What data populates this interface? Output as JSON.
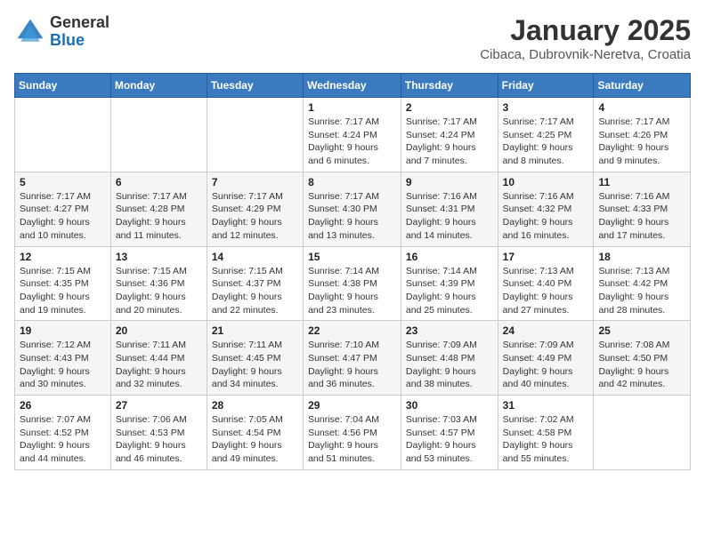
{
  "header": {
    "logo_general": "General",
    "logo_blue": "Blue",
    "month_title": "January 2025",
    "location": "Cibaca, Dubrovnik-Neretva, Croatia"
  },
  "weekdays": [
    "Sunday",
    "Monday",
    "Tuesday",
    "Wednesday",
    "Thursday",
    "Friday",
    "Saturday"
  ],
  "weeks": [
    [
      {
        "day": "",
        "info": ""
      },
      {
        "day": "",
        "info": ""
      },
      {
        "day": "",
        "info": ""
      },
      {
        "day": "1",
        "info": "Sunrise: 7:17 AM\nSunset: 4:24 PM\nDaylight: 9 hours and 6 minutes."
      },
      {
        "day": "2",
        "info": "Sunrise: 7:17 AM\nSunset: 4:24 PM\nDaylight: 9 hours and 7 minutes."
      },
      {
        "day": "3",
        "info": "Sunrise: 7:17 AM\nSunset: 4:25 PM\nDaylight: 9 hours and 8 minutes."
      },
      {
        "day": "4",
        "info": "Sunrise: 7:17 AM\nSunset: 4:26 PM\nDaylight: 9 hours and 9 minutes."
      }
    ],
    [
      {
        "day": "5",
        "info": "Sunrise: 7:17 AM\nSunset: 4:27 PM\nDaylight: 9 hours and 10 minutes."
      },
      {
        "day": "6",
        "info": "Sunrise: 7:17 AM\nSunset: 4:28 PM\nDaylight: 9 hours and 11 minutes."
      },
      {
        "day": "7",
        "info": "Sunrise: 7:17 AM\nSunset: 4:29 PM\nDaylight: 9 hours and 12 minutes."
      },
      {
        "day": "8",
        "info": "Sunrise: 7:17 AM\nSunset: 4:30 PM\nDaylight: 9 hours and 13 minutes."
      },
      {
        "day": "9",
        "info": "Sunrise: 7:16 AM\nSunset: 4:31 PM\nDaylight: 9 hours and 14 minutes."
      },
      {
        "day": "10",
        "info": "Sunrise: 7:16 AM\nSunset: 4:32 PM\nDaylight: 9 hours and 16 minutes."
      },
      {
        "day": "11",
        "info": "Sunrise: 7:16 AM\nSunset: 4:33 PM\nDaylight: 9 hours and 17 minutes."
      }
    ],
    [
      {
        "day": "12",
        "info": "Sunrise: 7:15 AM\nSunset: 4:35 PM\nDaylight: 9 hours and 19 minutes."
      },
      {
        "day": "13",
        "info": "Sunrise: 7:15 AM\nSunset: 4:36 PM\nDaylight: 9 hours and 20 minutes."
      },
      {
        "day": "14",
        "info": "Sunrise: 7:15 AM\nSunset: 4:37 PM\nDaylight: 9 hours and 22 minutes."
      },
      {
        "day": "15",
        "info": "Sunrise: 7:14 AM\nSunset: 4:38 PM\nDaylight: 9 hours and 23 minutes."
      },
      {
        "day": "16",
        "info": "Sunrise: 7:14 AM\nSunset: 4:39 PM\nDaylight: 9 hours and 25 minutes."
      },
      {
        "day": "17",
        "info": "Sunrise: 7:13 AM\nSunset: 4:40 PM\nDaylight: 9 hours and 27 minutes."
      },
      {
        "day": "18",
        "info": "Sunrise: 7:13 AM\nSunset: 4:42 PM\nDaylight: 9 hours and 28 minutes."
      }
    ],
    [
      {
        "day": "19",
        "info": "Sunrise: 7:12 AM\nSunset: 4:43 PM\nDaylight: 9 hours and 30 minutes."
      },
      {
        "day": "20",
        "info": "Sunrise: 7:11 AM\nSunset: 4:44 PM\nDaylight: 9 hours and 32 minutes."
      },
      {
        "day": "21",
        "info": "Sunrise: 7:11 AM\nSunset: 4:45 PM\nDaylight: 9 hours and 34 minutes."
      },
      {
        "day": "22",
        "info": "Sunrise: 7:10 AM\nSunset: 4:47 PM\nDaylight: 9 hours and 36 minutes."
      },
      {
        "day": "23",
        "info": "Sunrise: 7:09 AM\nSunset: 4:48 PM\nDaylight: 9 hours and 38 minutes."
      },
      {
        "day": "24",
        "info": "Sunrise: 7:09 AM\nSunset: 4:49 PM\nDaylight: 9 hours and 40 minutes."
      },
      {
        "day": "25",
        "info": "Sunrise: 7:08 AM\nSunset: 4:50 PM\nDaylight: 9 hours and 42 minutes."
      }
    ],
    [
      {
        "day": "26",
        "info": "Sunrise: 7:07 AM\nSunset: 4:52 PM\nDaylight: 9 hours and 44 minutes."
      },
      {
        "day": "27",
        "info": "Sunrise: 7:06 AM\nSunset: 4:53 PM\nDaylight: 9 hours and 46 minutes."
      },
      {
        "day": "28",
        "info": "Sunrise: 7:05 AM\nSunset: 4:54 PM\nDaylight: 9 hours and 49 minutes."
      },
      {
        "day": "29",
        "info": "Sunrise: 7:04 AM\nSunset: 4:56 PM\nDaylight: 9 hours and 51 minutes."
      },
      {
        "day": "30",
        "info": "Sunrise: 7:03 AM\nSunset: 4:57 PM\nDaylight: 9 hours and 53 minutes."
      },
      {
        "day": "31",
        "info": "Sunrise: 7:02 AM\nSunset: 4:58 PM\nDaylight: 9 hours and 55 minutes."
      },
      {
        "day": "",
        "info": ""
      }
    ]
  ]
}
